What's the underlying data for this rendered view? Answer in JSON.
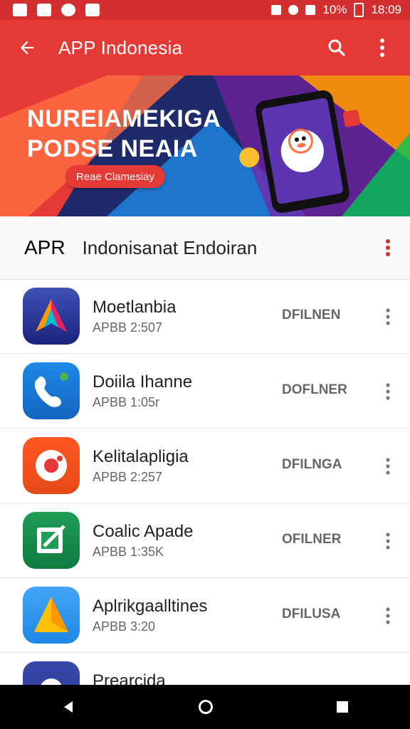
{
  "status_bar": {
    "battery": "10%",
    "time": "18:09",
    "icons": [
      "image-icon",
      "photo-icon",
      "location-icon",
      "gallery-icon",
      "bluetooth-icon",
      "wifi-icon",
      "signal-icon"
    ]
  },
  "app_bar": {
    "title": "APP Indonesia",
    "colors": {
      "primary": "#e53935",
      "status": "#d32f2f"
    },
    "icons": [
      "back-arrow-icon",
      "search-icon",
      "more-vert-icon"
    ]
  },
  "banner": {
    "headline_line1": "NUREIAMEKIGA",
    "headline_line2": "PODSE NEAIA",
    "cta": "Reae Clamesiay"
  },
  "section": {
    "left_label": "APR",
    "title": "Indonisanat Endoiran"
  },
  "apps": [
    {
      "name": "Moetlanbia",
      "size": "APBB 2:507",
      "action": "DFILNEN",
      "icon": "arrow-logo-icon",
      "color_top": "#3f51b5",
      "color_bottom": "#1a237e"
    },
    {
      "name": "Doiila Ihanne",
      "size": "APBB 1:05r",
      "action": "DOFLNER",
      "icon": "phone-icon",
      "color_top": "#1e88e5",
      "color_bottom": "#1565c0"
    },
    {
      "name": "Kelitalapligia",
      "size": "APBB 2:257",
      "action": "DFILNGA",
      "icon": "camera-icon",
      "color_top": "#ff5722",
      "color_bottom": "#e64a19"
    },
    {
      "name": "Coalic Apade",
      "size": "APBB 1:35K",
      "action": "OFILNER",
      "icon": "edit-icon",
      "color_top": "#1e9e57",
      "color_bottom": "#0f7a40"
    },
    {
      "name": "Aplrikgaalltines",
      "size": "APBB 3:20",
      "action": "DFILUSA",
      "icon": "triangle-logo-icon",
      "color_top": "#42a5f5",
      "color_bottom": "#1e88e5"
    },
    {
      "name": "Prearcida",
      "size": "",
      "action": "",
      "icon": "gear-icon",
      "color_top": "#3949ab",
      "color_bottom": "#283593"
    }
  ],
  "nav_bar": {
    "icons": [
      "back-triangle-icon",
      "home-circle-icon",
      "recents-square-icon"
    ]
  }
}
